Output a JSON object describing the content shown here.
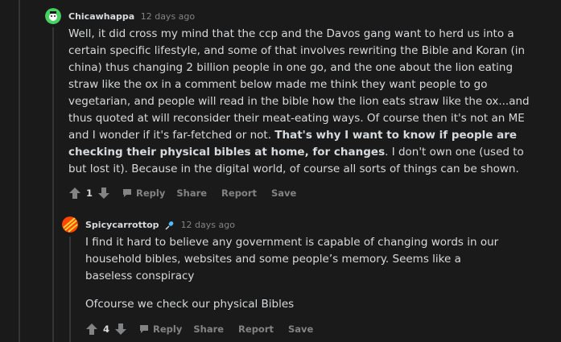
{
  "comment1": {
    "author": "Chicawhappa",
    "time": "12 days ago",
    "text_before": "Well, it did cross my mind that the ccp and the Davos gang want to herd us into a certain specific lifestyle, and some of that involves rewriting the Bible and Koran (in china) thus changing 2 billion people in one go, and the one about the lion eating straw like the ox in a comment below made me think they want people to go vegetarian, and people will read in the bible how the lion eats straw like the ox...and thus quoted at will reconsider their meat-eating ways. Of course then it's not an ME and I wonder if it's far-fetched or not. ",
    "text_bold": "That's why I want to know if people are checking their physical bibles at home, for changes",
    "text_after": ". I don't own one (used to but lost it). Because in the digital world, of course all sorts of things can be shown.",
    "score": "1",
    "actions": {
      "reply": "Reply",
      "share": "Share",
      "report": "Report",
      "save": "Save"
    }
  },
  "comment2": {
    "author": "Spicycarrottop",
    "time": "12 days ago",
    "paragraph1": "I find it hard to believe any government is capable of changing words in our household bibles, websites and some people’s memory. Seems like a baseless conspiracy",
    "paragraph2": "Ofcourse we check our physical Bibles",
    "score": "4",
    "actions": {
      "reply": "Reply",
      "share": "Share",
      "report": "Report",
      "save": "Save"
    }
  },
  "colors": {
    "background": "#1a1a1b",
    "text": "#d7dadc",
    "muted": "#818384",
    "thread_line": "#343536",
    "avatar1_bg": "#46d160",
    "avatar2_bg": "#ff4500"
  },
  "icons": [
    "upvote-icon",
    "downvote-icon",
    "reply-icon",
    "mic-icon",
    "avatar-icon"
  ]
}
